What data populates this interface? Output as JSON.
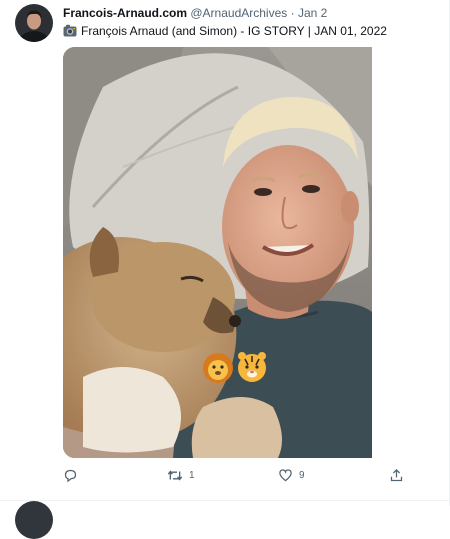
{
  "tweet": {
    "author_name": "Francois-Arnaud.com",
    "author_handle": "@ArnaudArchives",
    "separator": " · ",
    "date": "Jan 2",
    "text": "François Arnaud (and Simon) - IG STORY | JAN 01, 2022",
    "text_icon": "camera-emoji-icon",
    "media_icon": "photo-icon",
    "stickers": [
      "lion-face-emoji",
      "tiger-face-emoji"
    ]
  },
  "actions": {
    "reply": {
      "icon": "reply-icon",
      "count": ""
    },
    "retweet": {
      "icon": "retweet-icon",
      "count": "1"
    },
    "like": {
      "icon": "heart-icon",
      "count": "9"
    },
    "share": {
      "icon": "share-icon",
      "count": ""
    }
  },
  "colors": {
    "text": "#0f1419",
    "secondary": "#536471",
    "divider": "#eff3f4"
  }
}
